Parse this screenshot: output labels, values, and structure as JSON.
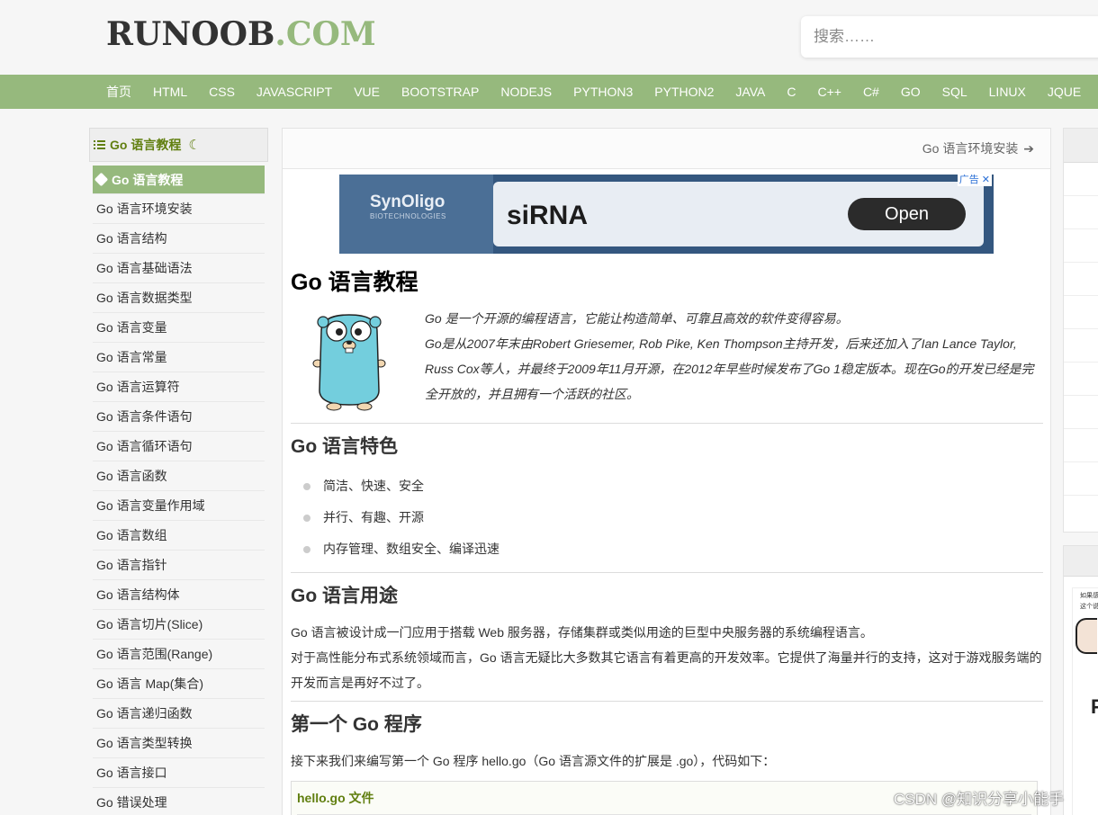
{
  "header": {
    "logo_main": "RUNOOB",
    "logo_dot": ".COM",
    "search_placeholder": "搜索……"
  },
  "nav": {
    "items": [
      "首页",
      "HTML",
      "CSS",
      "JAVASCRIPT",
      "VUE",
      "BOOTSTRAP",
      "NODEJS",
      "PYTHON3",
      "PYTHON2",
      "JAVA",
      "C",
      "C++",
      "C#",
      "GO",
      "SQL",
      "LINUX",
      "JQUE"
    ]
  },
  "sidebar": {
    "title": "Go 语言教程",
    "items": [
      "Go 语言教程",
      "Go 语言环境安装",
      "Go 语言结构",
      "Go 语言基础语法",
      "Go 语言数据类型",
      "Go 语言变量",
      "Go 语言常量",
      "Go 语言运算符",
      "Go 语言条件语句",
      "Go 语言循环语句",
      "Go 语言函数",
      "Go 语言变量作用域",
      "Go 语言数组",
      "Go 语言指针",
      "Go 语言结构体",
      "Go 语言切片(Slice)",
      "Go 语言范围(Range)",
      "Go 语言 Map(集合)",
      "Go 语言递归函数",
      "Go 语言类型转换",
      "Go 语言接口",
      "Go 错误处理"
    ]
  },
  "main": {
    "next_link": "Go 语言环境安装",
    "ad": {
      "brand": "SynOligo",
      "brand_sub": "BIOTECHNOLOGIES",
      "headline": "siRNA",
      "button": "Open",
      "flag": "广告 ✕"
    },
    "title": "Go 语言教程",
    "intro_line1": "Go 是一个开源的编程语言，它能让构造简单、可靠且高效的软件变得容易。",
    "intro_line2": "Go是从2007年末由Robert Griesemer, Rob Pike, Ken Thompson主持开发，后来还加入了Ian Lance Taylor, Russ Cox等人，并最终于2009年11月开源，在2012年早些时候发布了Go 1稳定版本。现在Go的开发已经是完全开放的，并且拥有一个活跃的社区。",
    "features_heading": "Go 语言特色",
    "features": [
      "简洁、快速、安全",
      "并行、有趣、开源",
      "内存管理、数组安全、编译迅速"
    ],
    "usage_heading": "Go 语言用途",
    "usage_p1": "Go 语言被设计成一门应用于搭载 Web 服务器，存储集群或类似用途的巨型中央服务器的系统编程语言。",
    "usage_p2": "对于高性能分布式系统领域而言，Go 语言无疑比大多数其它语言有着更高的开发效率。它提供了海量并行的支持，这对于游戏服务端的开发而言是再好不过了。",
    "first_heading": "第一个 Go 程序",
    "first_p": "接下来我们来编写第一个 Go 程序 hello.go（Go 语言源文件的扩展是 .go），代码如下：",
    "code_title": "hello.go 文件"
  },
  "right": {
    "thumb_line1": "如果感",
    "thumb_line2": "这个说",
    "thumb_letter": "F"
  },
  "watermark": "CSDN @知识分享小能手",
  "colors": {
    "accent": "#96b97d",
    "accent_dark": "#617f10",
    "background": "#f6f6f6"
  }
}
